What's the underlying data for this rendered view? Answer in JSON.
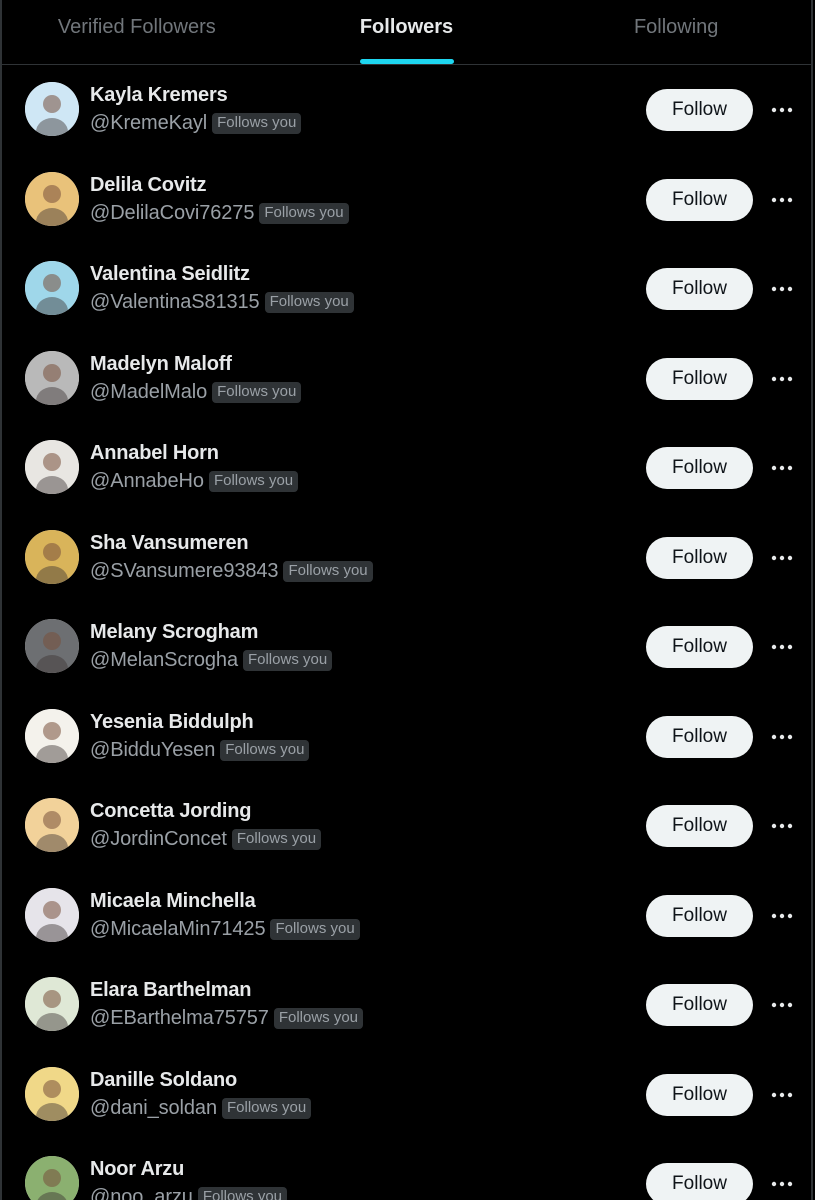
{
  "tabs": [
    {
      "label": "Verified Followers",
      "active": false
    },
    {
      "label": "Followers",
      "active": true
    },
    {
      "label": "Following",
      "active": false
    }
  ],
  "badge_text": "Follows you",
  "follow_label": "Follow",
  "users": [
    {
      "name": "Kayla Kremers",
      "handle": "@KremeKayl",
      "avatar_color": "#cfe7f5"
    },
    {
      "name": "Delila Covitz",
      "handle": "@DelilaCovi76275",
      "avatar_color": "#e9c27a"
    },
    {
      "name": "Valentina Seidlitz",
      "handle": "@ValentinaS81315",
      "avatar_color": "#9fd7ea"
    },
    {
      "name": "Madelyn Maloff",
      "handle": "@MadelMalo",
      "avatar_color": "#b9b9b9"
    },
    {
      "name": "Annabel Horn",
      "handle": "@AnnabeHo",
      "avatar_color": "#e8e6e2"
    },
    {
      "name": "Sha Vansumeren",
      "handle": "@SVansumere93843",
      "avatar_color": "#d9b45a"
    },
    {
      "name": "Melany Scrogham",
      "handle": "@MelanScrogha",
      "avatar_color": "#6d6f72"
    },
    {
      "name": "Yesenia Biddulph",
      "handle": "@BidduYesen",
      "avatar_color": "#f4f2ec"
    },
    {
      "name": "Concetta Jording",
      "handle": "@JordinConcet",
      "avatar_color": "#f2d29a"
    },
    {
      "name": "Micaela Minchella",
      "handle": "@MicaelaMin71425",
      "avatar_color": "#e6e4ea"
    },
    {
      "name": "Elara Barthelman",
      "handle": "@EBarthelma75757",
      "avatar_color": "#dfe8d6"
    },
    {
      "name": "Danille Soldano",
      "handle": "@dani_soldan",
      "avatar_color": "#f0d888"
    },
    {
      "name": "Noor Arzu",
      "handle": "@noo_arzu",
      "avatar_color": "#8bb070"
    }
  ]
}
